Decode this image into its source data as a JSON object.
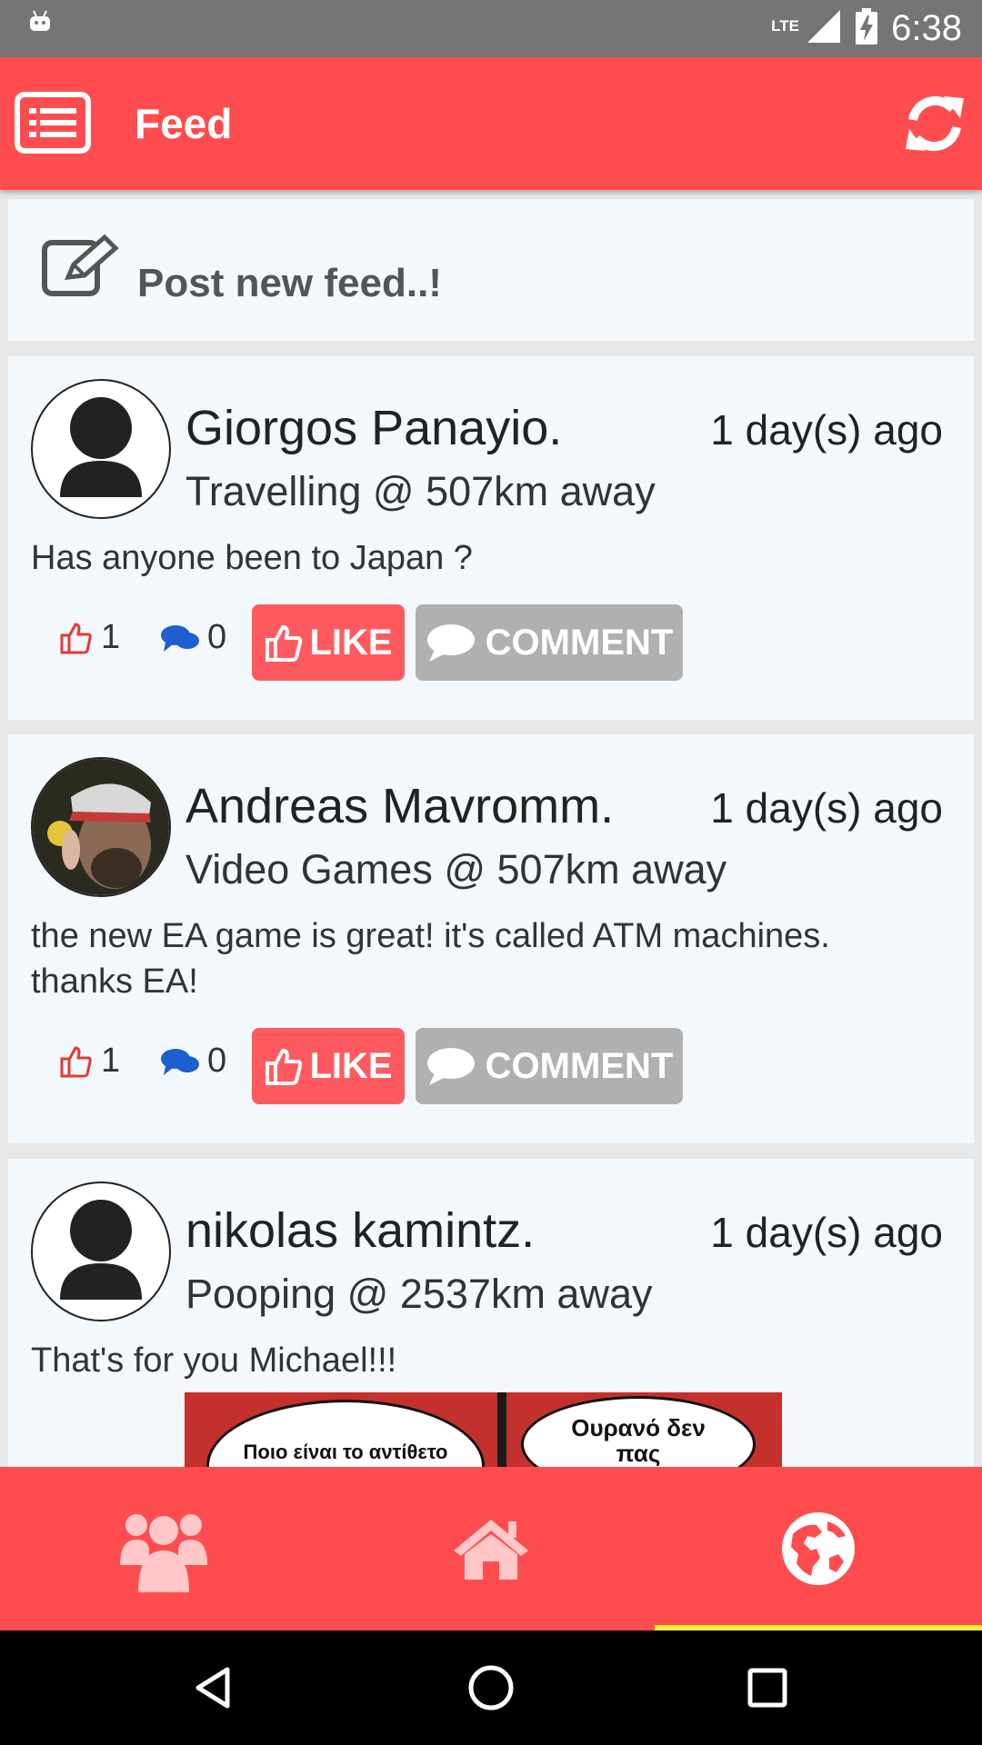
{
  "status_bar": {
    "time": "6:38",
    "network": "LTE"
  },
  "app_bar": {
    "title": "Feed"
  },
  "composer": {
    "label": "Post new feed..!"
  },
  "posts": [
    {
      "name": "Giorgos Panayio.",
      "time": "1 day(s) ago",
      "meta": "Travelling @ 507km away",
      "text": "Has anyone been to Japan ?",
      "likes": "1",
      "comments": "0",
      "avatar": "default-user",
      "like_label": "LIKE",
      "comment_label": "COMMENT"
    },
    {
      "name": "Andreas Mavromm.",
      "time": "1 day(s) ago",
      "meta": "Video Games @ 507km away",
      "text": "the new EA game is great! it's called ATM machines. thanks EA!",
      "likes": "1",
      "comments": "0",
      "avatar": "photo",
      "like_label": "LIKE",
      "comment_label": "COMMENT"
    },
    {
      "name": "nikolas kamintz.",
      "time": "1 day(s) ago",
      "meta": "Pooping @ 2537km away",
      "text": "That's for you Michael!!!",
      "avatar": "default-user",
      "image_text_left": "Ποιο είναι το αντίθετο",
      "image_text_right": "Ουρανό δεν πας"
    }
  ],
  "bottom_nav": {
    "items": [
      {
        "icon": "group-icon",
        "selected": false
      },
      {
        "icon": "home-icon",
        "selected": false
      },
      {
        "icon": "globe-icon",
        "selected": true
      }
    ]
  },
  "colors": {
    "accent": "#ff4d4f",
    "like": "#ff5a5f",
    "comment": "#b0b0b0",
    "indicator": "#ffeb3b",
    "card": "#f2f8fc"
  }
}
